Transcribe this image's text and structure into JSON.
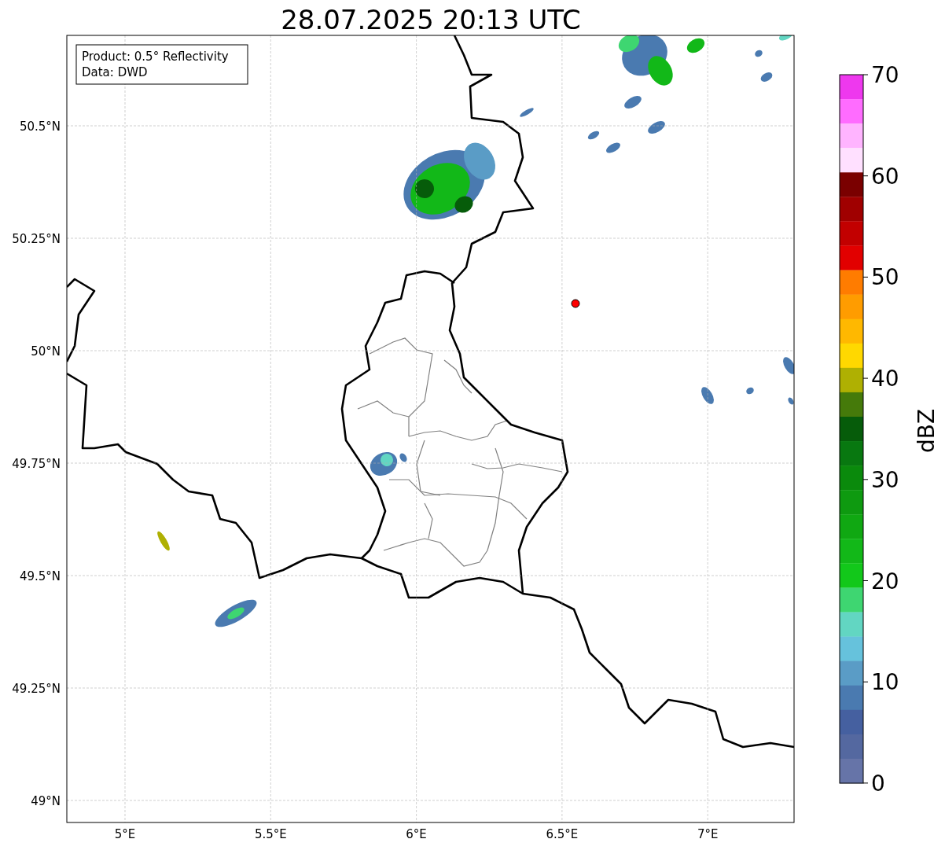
{
  "title": "28.07.2025 20:13 UTC",
  "info_box": [
    "Product: 0.5° Reflectivity",
    "Data: DWD"
  ],
  "y_axis": {
    "ticks": [
      "50.5°N",
      "50.25°N",
      "50°N",
      "49.75°N",
      "49.5°N",
      "49.25°N",
      "49°N"
    ]
  },
  "x_axis": {
    "ticks": [
      "5°E",
      "5.5°E",
      "6°E",
      "6.5°E",
      "7°E"
    ]
  },
  "colorbar": {
    "label": "dBZ",
    "ticks": [
      "70",
      "60",
      "50",
      "40",
      "30",
      "20",
      "10",
      "0"
    ],
    "bands": [
      {
        "color": "#ee38ee"
      },
      {
        "color": "#ff6cff"
      },
      {
        "color": "#ffb4ff"
      },
      {
        "color": "#ffe0ff"
      },
      {
        "color": "#7a0000"
      },
      {
        "color": "#a00000"
      },
      {
        "color": "#c20000"
      },
      {
        "color": "#e20000"
      },
      {
        "color": "#ff7c00"
      },
      {
        "color": "#ff9c00"
      },
      {
        "color": "#ffb800"
      },
      {
        "color": "#ffd800"
      },
      {
        "color": "#afb002"
      },
      {
        "color": "#457a0a"
      },
      {
        "color": "#065c0a"
      },
      {
        "color": "#087810"
      },
      {
        "color": "#0a8a0c"
      },
      {
        "color": "#0e9a10"
      },
      {
        "color": "#10a812"
      },
      {
        "color": "#12b818"
      },
      {
        "color": "#12c81a"
      },
      {
        "color": "#3ed671"
      },
      {
        "color": "#62d6c2"
      },
      {
        "color": "#66c2dc"
      },
      {
        "color": "#5a9cc6"
      },
      {
        "color": "#4a7ab0"
      },
      {
        "color": "#4560a0"
      },
      {
        "color": "#5468a0"
      },
      {
        "color": "#6674a8"
      }
    ]
  }
}
